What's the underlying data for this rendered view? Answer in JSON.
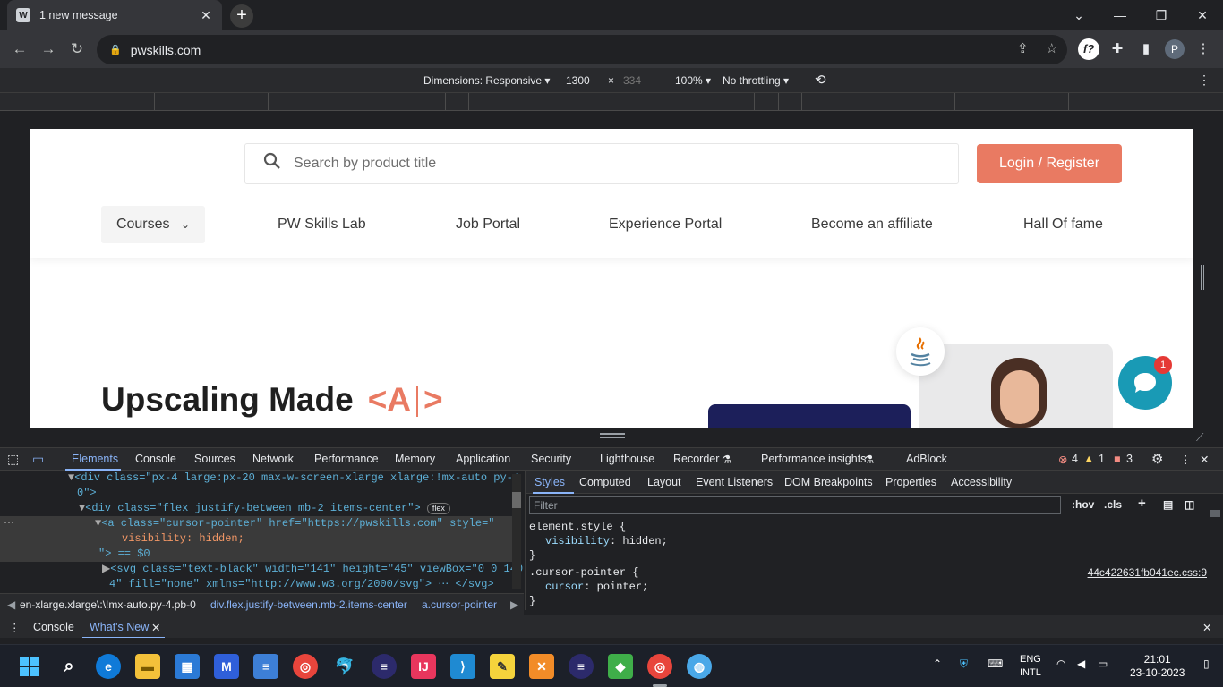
{
  "browser": {
    "tab_title": "1 new message",
    "url": "pwskills.com",
    "profile_initial": "P"
  },
  "devtools_device_bar": {
    "dimensions_label": "Dimensions: Responsive ▾",
    "width": "1300",
    "times": "×",
    "height": "334",
    "zoom": "100% ▾",
    "throttling": "No throttling ▾"
  },
  "site": {
    "search_placeholder": "Search by product title",
    "login_label": "Login / Register",
    "nav": {
      "courses": "Courses",
      "lab": "PW Skills Lab",
      "jobs": "Job Portal",
      "experience": "Experience Portal",
      "affiliate": "Become an affiliate",
      "hall": "Hall Of fame"
    },
    "hero_title": "Upscaling Made",
    "hero_open": "<A",
    "hero_close": ">",
    "chat_badge": "1"
  },
  "devtools": {
    "tabs": [
      "Elements",
      "Console",
      "Sources",
      "Network",
      "Performance",
      "Memory",
      "Application",
      "Security",
      "Lighthouse",
      "Recorder",
      "Performance insights",
      "AdBlock"
    ],
    "error_count": "4",
    "warning_count": "1",
    "issue_count": "3",
    "dom_lines": [
      "<div class=\"px-4 large:px-20 max-w-screen-xlarge xlarge:!mx-auto py-4 pb-",
      "0\">",
      "<div class=\"flex justify-between mb-2 items-center\">",
      "<a class=\"cursor-pointer\" href=\"https://pwskills.com\" style=\"",
      "visibility: hidden;",
      "\"> == $0",
      "<svg class=\"text-black\" width=\"141\" height=\"45\" viewBox=\"0 0 140 4",
      "4\" fill=\"none\" xmlns=\"http://www.w3.org/2000/svg\"> ⋯ </svg>"
    ],
    "flex_badge": "flex",
    "breadcrumbs": [
      "en-xlarge.xlarge\\:\\!mx-auto.py-4.pb-0",
      "div.flex.justify-between.mb-2.items-center",
      "a.cursor-pointer"
    ],
    "styles_tabs": [
      "Styles",
      "Computed",
      "Layout",
      "Event Listeners",
      "DOM Breakpoints",
      "Properties",
      "Accessibility"
    ],
    "filter_placeholder": "Filter",
    "hov": ":hov",
    "cls": ".cls",
    "rules": {
      "r1_selector": "element.style {",
      "r1_prop": "visibility",
      "r1_val": "hidden;",
      "r1_close": "}",
      "r2_selector": ".cursor-pointer {",
      "r2_source": "44c422631fb041ec.css:9",
      "r2_prop": "cursor",
      "r2_val": "pointer;",
      "r2_close": "}"
    },
    "drawer_tabs": [
      "Console",
      "What's New"
    ]
  },
  "taskbar": {
    "lang_top": "ENG",
    "lang_bottom": "INTL",
    "time": "21:01",
    "date": "23-10-2023"
  }
}
